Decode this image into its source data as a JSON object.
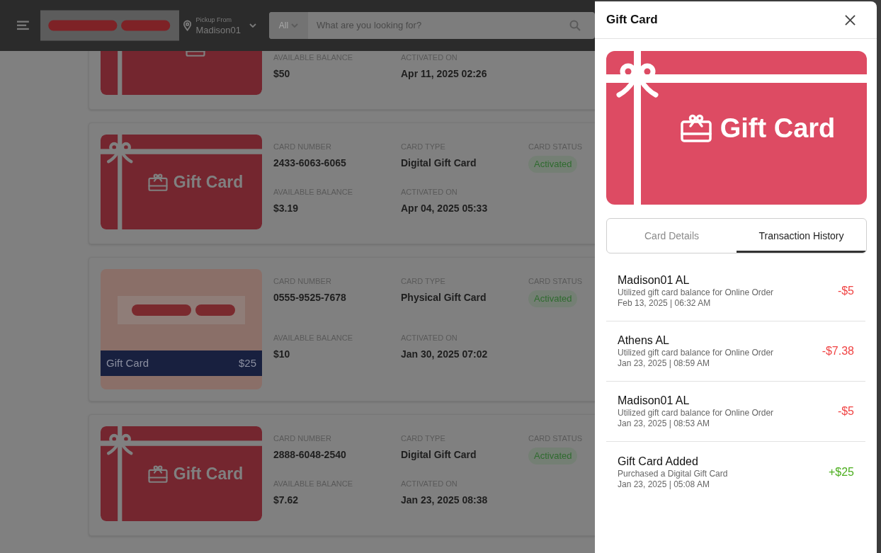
{
  "header": {
    "pickup_label": "Pickup From",
    "pickup_store": "Madison01",
    "search_category": "All",
    "search_placeholder": "What are you looking for?"
  },
  "cards": [
    {
      "kind": "digital",
      "available_balance_label": "AVAILABLE BALANCE",
      "available_balance": "$50",
      "activated_on_label": "ACTIVATED ON",
      "activated_on": "Apr 11, 2025 02:26"
    },
    {
      "kind": "digital",
      "art_label": "Gift Card",
      "card_number_label": "CARD NUMBER",
      "card_number": "2433-6063-6065",
      "card_type_label": "CARD TYPE",
      "card_type": "Digital Gift Card",
      "card_status_label": "CARD STATUS",
      "card_status": "Activated",
      "available_balance_label": "AVAILABLE BALANCE",
      "available_balance": "$3.19",
      "activated_on_label": "ACTIVATED ON",
      "activated_on": "Apr 04, 2025 05:33"
    },
    {
      "kind": "physical",
      "art_label": "Gift Card",
      "art_value": "$25",
      "card_number_label": "CARD NUMBER",
      "card_number": "0555-9525-7678",
      "card_type_label": "CARD TYPE",
      "card_type": "Physical Gift Card",
      "card_status_label": "CARD STATUS",
      "card_status": "Activated",
      "available_balance_label": "AVAILABLE BALANCE",
      "available_balance": "$10",
      "activated_on_label": "ACTIVATED ON",
      "activated_on": "Jan 30, 2025 07:02"
    },
    {
      "kind": "digital",
      "art_label": "Gift Card",
      "card_number_label": "CARD NUMBER",
      "card_number": "2888-6048-2540",
      "card_type_label": "CARD TYPE",
      "card_type": "Digital Gift Card",
      "card_status_label": "CARD STATUS",
      "card_status": "Activated",
      "available_balance_label": "AVAILABLE BALANCE",
      "available_balance": "$7.62",
      "activated_on_label": "ACTIVATED ON",
      "activated_on": "Jan 23, 2025 08:38"
    }
  ],
  "drawer": {
    "title": "Gift Card",
    "card_art_label": "Gift Card",
    "tabs": [
      {
        "label": "Card Details",
        "selected": false
      },
      {
        "label": "Transaction History",
        "selected": true
      }
    ],
    "transactions": [
      {
        "title": "Madison01 AL",
        "description": "Utilized gift card balance for Online Order",
        "date": "Feb 13, 2025 | 06:32 AM",
        "amount": "-$5",
        "kind": "debit"
      },
      {
        "title": "Athens AL",
        "description": "Utilized gift card balance for Online Order",
        "date": "Jan 23, 2025 | 08:59 AM",
        "amount": "-$7.38",
        "kind": "debit"
      },
      {
        "title": "Madison01 AL",
        "description": "Utilized gift card balance for Online Order",
        "date": "Jan 23, 2025 | 08:53 AM",
        "amount": "-$5",
        "kind": "debit"
      },
      {
        "title": "Gift Card Added",
        "description": "Purchased a Digital Gift Card",
        "date": "Jan 23, 2025 | 05:08 AM",
        "amount": "+$25",
        "kind": "credit"
      }
    ]
  }
}
